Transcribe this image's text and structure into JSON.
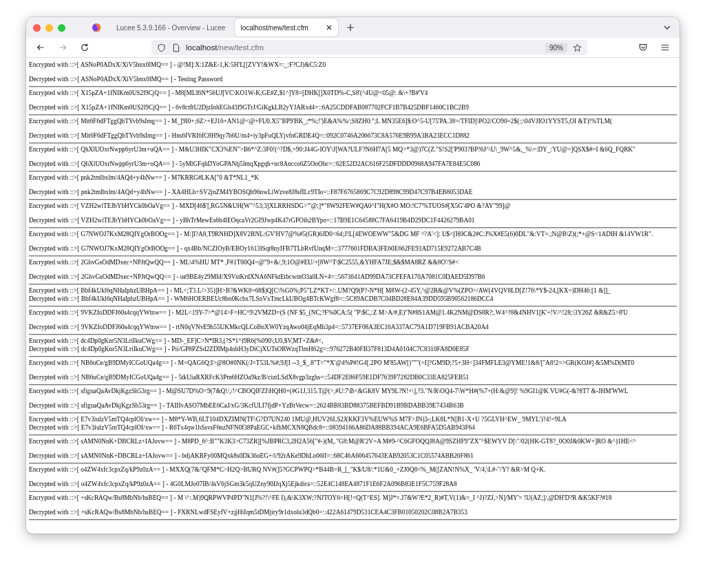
{
  "window": {
    "tabs": [
      {
        "title": "Lucee 5.3.9.166 - Overview - Lucee",
        "selected": false
      },
      {
        "title": "localhost/new/test.cfm",
        "selected": true
      }
    ],
    "url_host": "localhost",
    "url_path": "/new/test.cfm",
    "zoom": "90%"
  },
  "groups": [
    {
      "encrypted": "Encrypted with ::>[ ASNoP0ADxX/XiV5bnx0lMQ== ] - @!M]:X:1Z&E-1,K:5H'L[[ZVY!&WX=:_:F?CJ)&C5:Z0",
      "decrypted": "Decrypted with ::>[ ASNoP0ADxX/XiV5bnx0lMQ== ] - Testing Password",
      "compact": false
    },
    {
      "encrypted": "Encrypted with ::>[ X15pZA+1fNIKm0US2l9CjQ== ] - M8[MLI6N*56UJ[VC\\KO1W-K;GE#Z,$1^]Y8=[DHK[]X0TD%-C,S8'(^4U@<05@: &\\+?B#'V4",
      "decrypted": "Decrypted with ::>[ X15pZA+1fNIKm0US2l9CjQ== ] - 6v8ctftU2DjzIohEGh43l9GTrJ/GiKgkLB2yYJARxd4=::6A25CDDFAB087702FCF1B7B425DBF1460C1BC2B9",
      "compact": false
    },
    {
      "encrypted": "Encrypted with ::>[ Mit6F6dFTggQbTYvb9sImg== ] - M_]9I0+;6Z>+EJ16+AN1@<@+FU0.X5\"BP9'BK_;*%;!')E&A%%/;S8ZH0:\";L MN35E6]$:O^5-U[75'PA.38=/TFID]\\PO2/CO90=2$(:;\\04VJIO1YYST5,OI &T)!%TLM(",
      "decrypted": "Decrypted with ::>[ Mit6F6dFTggQbTYvb9sImg== ] - Hns6fVRI6fC8H9qy7b6U/m4+iy3pFuQLYjvfnGRDE4Q=::092C0746A206673C8A576E9B99A3BA23ECC1D882",
      "compact": false
    },
    {
      "encrypted": "Encrypted with ::>[ QhXlUOxrNwpp6yrU3m+uQA== ] - M&U3HIK\"CX3%EN\">B6*^Z:3F0!(^?D$,=90:J44G-IOY\\J[WA?ULF?N6H7A[5 MQ>*3@)7C(Z.\"S!S2['P903?BP!6J^\\U\\_9W^5&,_%\\=:DY_:YU@=]QSX$#=I &6Q_FQRK\"",
      "decrypted": "Decrypted with ::>[ QhXlUOxrNwpp6yrU3m+uQA== ] - 5yMlGFqhDYoGPANtj5lmqXpgqh+nc8Ancco6Z5OoOhc=::62E52D2AC616F25DFDDD0968A947FA7E84E5C086",
      "compact": false
    },
    {
      "encrypted": "Encrypted with ::>[ pnk2tmlbxlm/4AQd+y4hNw== ] - M7KRRG#LKA[\"0 &T*NL1_*K",
      "decrypted": "Decrypted with ::>[ pnk2tmlbxlm/4AQd+y4hNw== ] - XA4HLh+SV2jnZM4YBOSQb96nwLiWzve8J8sfILc9TIo=::F87F6765869C7C92D898C99D47C97B4EB8053DAE",
      "compact": false
    },
    {
      "encrypted": "Encrypted with ::>[ VZH2wiTEJbYbHYCk0bOaVg== ] - MXD[46$'[,RG5N&UH(W\"^53;3]XLRRHSDG>\"'@;]*\"8W92FEW#QA0^I\"H(X#O MO:!C7'%TUOS#[X5G'4PO &?AY\"99]@",
      "decrypted": "Decrypted with ::>[ VZH2wiTEJbYbHYCk0bOaVg== ] - yBhTrMewEs6b4lEOqcaVr2GI9Jwp4K47rGPOih2BYpo=::17B9E1C64588C7FA6419B4D29DC1F4426279BA01",
      "compact": false
    },
    {
      "encrypted": "Encrypted with ::>[ G7NWOJ7KxM28QIYgOrBOOg== ] - M:]I?A8,T9RNHD]X8V2RNL:GV'HV7@%#5(GR)6JD0<64;J!L[4EWOEWW\"5&DG MF ^?A'<]: U$<[H0C&2#C:J%X#E5(6)0DL\"&:VT=.;N@B\\Z)(;*+@S<1ADIH &14VW1R\".",
      "decrypted": "Decrypted with ::>[ G7NWOJ7KxM28QIYgOrBOOg== ] - qx4Bb/NCZlOyB/EBOy1613lSqt8nyIFB7TLbRvfUnqM=::3777601FDBA3FE60E662FE93AD715E9272AB7C4B",
      "compact": false
    },
    {
      "encrypted": "Encrypted with ::>[ 2GhvGsOdMDxec+NPJtQwQQ== ] - ML\\4%HU MT* ,F#1T00Q4=@\"9+&/,9;1O@#EU/+[8W^T\\$C2555,&YHFA7JE;$&$MA8RZ &&8O'/S#<",
      "decrypted": "Decrypted with ::>[ 2GhvGsOdMDxec+NPJtQwQQ== ] - ue9BE4y29MId/X9VstKrdXNA6NFktEtbcwmO3a0LN+4=::5673041AD99DA73CFEFA170A7081C0DAED5D97B6",
      "compact": false
    },
    {
      "encrypted": "Encrypted with ::>[ Bbf4kUkl6qNHaIphzUBHpA== ] - ML<;T3.L/>35)]H>B?&WK8=68$)Q[C\\%G0%;P5\"LZ*KT+/:.UM?Q9(P?-N*H[ M8W-(2-45Y,^@2R&@V%(ZPO>/AW(4VQV8LD[Z!76\\*Y$-24,[KX=)DH46:[1 &]]_",
      "decrypted": "Decrypted with ::>[ Bbf4kUkl6qNHaIphzUBHpA== ] - WM6HOERBEUc8bn0Kcbx7LSnVxTmcLkUBOg4BTcKWgf8=::5C89ACDB7C04BD28E84A39DD595B90562186DCC4",
      "compact": true
    },
    {
      "encrypted": "Encrypted with ::>[ 9VKZfoDDFJ60s4cqqYWtnw== ] - M2L<19Y-7>*@14>F=HC^9\\2VMZD=(S (NF $5_(NC;?F%0CA:5( \"P\\$C,:Z M>A/#,E)\"N#8S1AM@1.4K2NM@DS8R?;.W4^?8&4NHV1[K'+!V/^!28;\\3Y26Z &R&Z5>8'U",
      "decrypted": "Decrypted with ::>[ 9VKZfoDDFJ60s4cqqYWtnw== ] - rtN0qVNvE9h55UKMkcQLCoBnXW0YzqAwo04jEqMh3p4=::5737EF08A3EC16A337AC79A1D719FB91ACBA20A4",
      "compact": false
    },
    {
      "encrypted": "Encrypted with ::>[ dc4Dp0gKnr5N3LriIkuCWg== ] - MD-_EF]C>N*IR3,(?S*1^)9R6(%090\\;U0,$V,MT+Z&#<,",
      "decrypted": "Decrypted with ::>[ dc4Dp0gKnr5N3LriIkuCWg== ] - Pii/GP8PZSd2ZDIMp4obH3yDiCjXUTsORWzqTlmH62g=::976272B40FB37F813D4A0104C7C8310FA8D0E85F",
      "compact": true
    },
    {
      "encrypted": "Encrypted with ::>[ NB6uCe/gB9DMyICGoUQa4g== ] - M=QAG6Q;I>@8O#0NK(/J=T53L%#;9J[I --3_$_.8\"T<\"*X'@4%P#!G4[.2PO M'85AW[)\"\"\"(=I]?GM9D;?5+3H<]34FMFLE3@YME!1&8/[\"A8!2=>GR(KOJ#] &5M%D(MT0",
      "decrypted": "Decrypted with ::>[ NB6uCe/gB9DMyICGoUQa4g== ] - 5tkUiaRXRFcK3Pm6HZOa9kz/B/ciztLSdX8vgp3zghs=::54DF2E86F59E1DF7639F7282DB0C33EA825FEB51",
      "compact": false
    },
    {
      "encrypted": "Encrypted with ::>[ sfiguaQaAvDkjKgzSh53rg== ] - M@SU7D%O<9(7&Q!/,/!^CBOQIFZI\\HQH0+(#G1J,315.T@(>,#U:7\\B<&GK8V MY9L?N!+\\],?3.\"N/R\\OQ4-7\\W*H#(%7+(H:&@9]! %9GI1@K VU#G(-&?8T7 &-JHM'WWL",
      "decrypted": "Decrypted with ::>[ sfiguaQaAvDkjKgzSh53rg== ] - TAIIIvASO7MbEE6CaJ/xG/3KcfULI7fjdP+YzBtVecw=::2624BB83BD88375BEFBD91B9BDABB39E7434B63B",
      "compact": false
    },
    {
      "encrypted": "Encrypted with ::>[ E7v3iulzV5mTQ4cplOI/xw== ] - M8*Y-WB,6LT104DXZIMN(TF\\G?D7UN240 1MU@,HUV26LS2J(KKF3V%EUW%S M7F>JN)3-;LK8L*N[B1-X+U ?5GLVH^EW_ 9MYL')?4!=9LA",
      "decrypted": "Decrypted with ::>[ E7v3iulzV5mTQ4cplOI/xw== ] - R6Tx4qw1hSsvsF6nzNFN0f38PaEGC+kfhMCXN8QBdc8=::08394166A86DA88BB394ACA9E6BFA5D5AB943F64",
      "compact": true
    },
    {
      "encrypted": "Encrypted with ::>[ sAMN0NnK+DBCRLz+IAJovw== ] - M8PD_6^:B\"\"K3K3>C73ZR][%JBPRC3,2H2A56[\"#-)(M,.\"G8:M@R'2V=A M#9-^C6GFOQQJ8A@9SZHF9\"ZX\"^$EWYV D[\\\"/02(HK-GT8?_0O0J&0KW+]RO &^)1HE<^",
      "decrypted": "Decrypted with ::>[ sAMN0NnK+DBCRLz+IAJovw== ] - bdjAKRFy00MQxk8s0Dk36oEG+/i/92rAKe9DhLo06lI=::68C46A606457643EAB92053C1C05574ABB26F861",
      "compact": false
    },
    {
      "encrypted": "Encrypted with ::>[ o4ZW4xfc3cpxZq/kP9z0zA== ] - MXXQ(7&/'QFM*C>H2Q>BURQ NV#(]5?GCPWPQ>*B44B=R_[_\"K$/U8/:*1U&0_+ZJ0Q8<%_M([ZAN!N%X_ 'V/4,\\L#-\"/Y? &R>M Q+K.",
      "decrypted": "Decrypted with ::>[ o4ZW4xfc3cpxZq/kP9z0zA== ] - 4G0LMJo07IB/4sV6jSGm3k5qUZny90IJqXj5Ejkdics=::52E4C148EA4871F1E6F2A096B83E1F5C759F28A8",
      "compact": false
    },
    {
      "encrypted": "Encrypted with ::>[ +sKcRAQw/Bs8MbNb/hsBEQ== ] - M \\^:.M)9QRPWVP4PD\"N1[J%?!\\^FE I),&\\K3XW;?NJTOY6=H[!=Q(T^ES]. M]J*=.J7&W?E*2_R)#T,V(1)&=_I ^J)?ZJ,>N]/MY'= !U(AZ;]/,@DH'D?R &K5KF?#18",
      "decrypted": "Decrypted with ::>[ +sKcRAQw/Bs8MbNb/hsBEQ== ] - FXRNLwdFSEyfV+zjjHiIqm5tDMjiry9r1dxolu3dQb0=::422A61479D531CEA4C3FB01050202C08B2A7B353",
      "compact": false
    }
  ]
}
